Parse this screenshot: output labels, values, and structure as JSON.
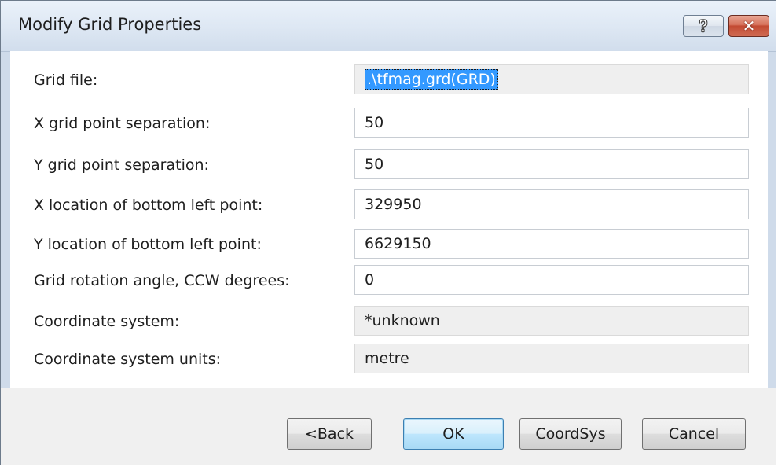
{
  "window": {
    "title": "Modify Grid Properties",
    "help_glyph": "?",
    "close_glyph": "✕"
  },
  "fields": [
    {
      "label": "Grid file:",
      "value": ".\\tfmag.grd(GRD)",
      "state": "selected-readonly"
    },
    {
      "label": "X grid point separation:",
      "value": "50",
      "state": "editable"
    },
    {
      "label": "Y grid point separation:",
      "value": "50",
      "state": "editable"
    },
    {
      "label": "X location of bottom left point:",
      "value": "329950",
      "state": "editable"
    },
    {
      "label": "Y location of bottom left point:",
      "value": "6629150",
      "state": "editable"
    },
    {
      "label": "Grid rotation angle, CCW degrees:",
      "value": "0",
      "state": "editable"
    },
    {
      "label": "Coordinate system:",
      "value": "*unknown",
      "state": "readonly"
    },
    {
      "label": "Coordinate system units:",
      "value": "metre",
      "state": "readonly"
    }
  ],
  "buttons": {
    "back": "<Back",
    "ok": "OK",
    "coordsys": "CoordSys",
    "cancel": "Cancel"
  },
  "colors": {
    "selection": "#3399ff",
    "close_button": "#c24a33",
    "default_button_border": "#3c7fb1"
  }
}
